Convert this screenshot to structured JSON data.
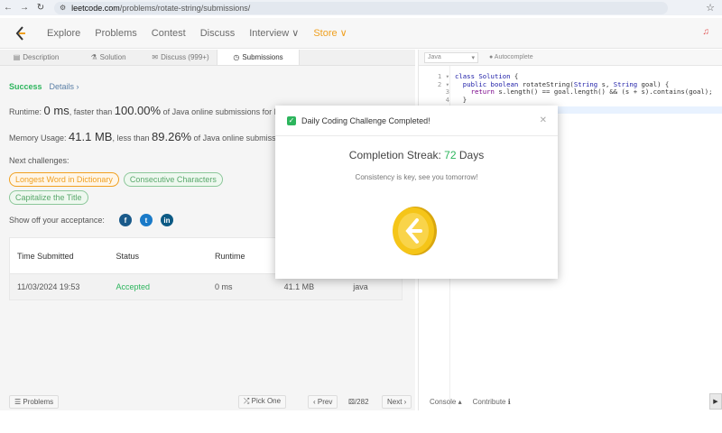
{
  "browser": {
    "url_host": "leetcode.com",
    "url_path": "/problems/rotate-string/submissions/"
  },
  "nav": {
    "items": [
      "Explore",
      "Problems",
      "Contest",
      "Discuss",
      "Interview ∨",
      "Store ∨"
    ]
  },
  "tabs": [
    "Description",
    "Solution",
    "Discuss (999+)",
    "Submissions"
  ],
  "result": {
    "status": "Success",
    "details": "Details ›",
    "runtime_label": "Runtime:",
    "runtime_value": "0 ms",
    "runtime_mid": ", faster than",
    "runtime_pct": "100.00%",
    "runtime_tail": "of Java online submissions for Rotate",
    "memory_label": "Memory Usage:",
    "memory_value": "41.1 MB",
    "memory_mid": ", less than",
    "memory_pct": "89.26%",
    "memory_tail": "of Java online submissions for",
    "next_label": "Next challenges:",
    "challenges": [
      {
        "label": "Longest Word in Dictionary",
        "color": "orange"
      },
      {
        "label": "Consecutive Characters",
        "color": "green"
      },
      {
        "label": "Capitalize the Title",
        "color": "green"
      }
    ],
    "share_label": "Show off your acceptance:"
  },
  "table": {
    "headers": [
      "Time Submitted",
      "Status",
      "Runtime",
      "",
      ""
    ],
    "rows": [
      [
        "11/03/2024 19:53",
        "Accepted",
        "0 ms",
        "41.1 MB",
        "java"
      ]
    ]
  },
  "bottombar": {
    "problems": "☰ Problems",
    "pick_one": "⤮ Pick One",
    "prev": "‹ Prev",
    "page": "⚄/282",
    "next": "Next ›"
  },
  "editor": {
    "language": "Java",
    "autocomplete": "● Autocomplete",
    "console": "Console ▴",
    "contribute": "Contribute ℹ",
    "gutter": [
      "1 ▾",
      "2 ▾",
      "3",
      "4"
    ]
  },
  "modal": {
    "title": "Daily Coding Challenge Completed!",
    "streak_prefix": "Completion Streak:",
    "streak_num": "72",
    "streak_suffix": "Days",
    "message": "Consistency is key, see you tomorrow!"
  }
}
